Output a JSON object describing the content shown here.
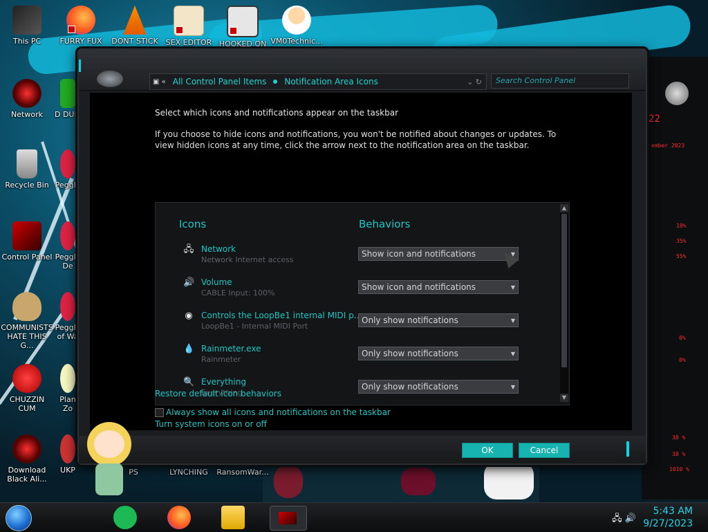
{
  "desktop": {
    "icons": [
      {
        "label": "This PC"
      },
      {
        "label": "FURRY FUX"
      },
      {
        "label": "DONT STICK"
      },
      {
        "label": "SEX EDITOR"
      },
      {
        "label": "HOOKED ON"
      },
      {
        "label": "VM0Technic..."
      },
      {
        "label": "Network"
      },
      {
        "label": "Recycle Bin"
      },
      {
        "label": "Control Panel"
      },
      {
        "label": "COMMUNISTS HATE THIS G..."
      },
      {
        "label": "CHUZZIN CUM"
      },
      {
        "label": "Download Black Ali..."
      },
      {
        "label": "D DUM"
      },
      {
        "label": "Peggle"
      },
      {
        "label": "Peggle De"
      },
      {
        "label": "Peggle of Wa"
      },
      {
        "label": "Plan Zo"
      },
      {
        "label": "UKP"
      },
      {
        "label": "PS"
      },
      {
        "label": "LYNCHING"
      },
      {
        "label": "RansomWar..."
      }
    ]
  },
  "window": {
    "address": {
      "segment1": "All Control Panel Items",
      "segment2": "Notification Area Icons"
    },
    "search_placeholder": "Search Control Panel",
    "heading": "Select which icons and notifications appear on the taskbar",
    "description": "If you choose to hide icons and notifications, you won't be notified about changes or updates. To view hidden icons at any time, click the arrow next to the notification area on the taskbar.",
    "columns": {
      "icons": "Icons",
      "behaviors": "Behaviors"
    },
    "rows": [
      {
        "icon": "network-icon",
        "name": "Network",
        "sub": "Network Internet access",
        "behavior": "Show icon and notifications"
      },
      {
        "icon": "volume-icon",
        "name": "Volume",
        "sub": "CABLE Input: 100%",
        "behavior": "Show icon and notifications"
      },
      {
        "icon": "midi-icon",
        "name": "Controls the LoopBe1 internal MIDI p...",
        "sub": "LoopBe1 - Internal MIDI Port",
        "behavior": "Only show notifications"
      },
      {
        "icon": "rainmeter-icon",
        "name": "Rainmeter.exe",
        "sub": "Rainmeter",
        "behavior": "Only show notifications"
      },
      {
        "icon": "everything-icon",
        "name": "Everything",
        "sub": "Everything",
        "behavior": "Only show notifications"
      }
    ],
    "links": {
      "system_icons": "Turn system icons on or off",
      "restore": "Restore default icon behaviors"
    },
    "checkbox_label": "Always show all icons and notifications on the taskbar",
    "checkbox_checked": false,
    "ok_label": "OK",
    "cancel_label": "Cancel"
  },
  "widget": {
    "t1": "22",
    "t2": "ember 2023",
    "p1": "18%",
    "p2": "35%",
    "p3": "55%",
    "p4": "0%",
    "p5": "0%",
    "p6": "38 %",
    "p7": "38 %",
    "p8": "1010 %"
  },
  "taskbar": {
    "time": "5:43 AM",
    "date": "9/27/2023"
  },
  "colors": {
    "accent": "#1ec6c4",
    "window_bg": "#000000",
    "ok_button": "#17b3b0"
  }
}
